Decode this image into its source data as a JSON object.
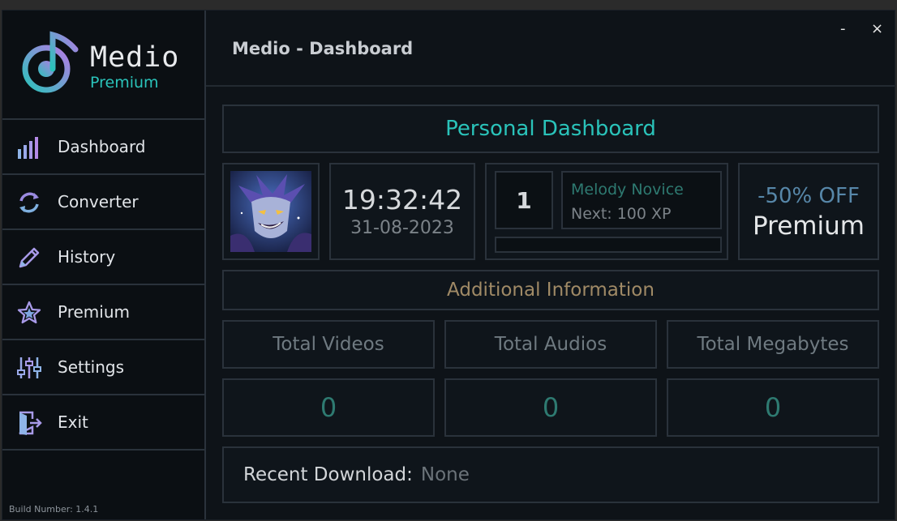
{
  "app": {
    "name": "Medio",
    "tier": "Premium",
    "window_title": "Medio - Dashboard",
    "minimize_glyph": "-",
    "close_glyph": "×",
    "build_number": "Build Number: 1.4.1"
  },
  "sidebar": {
    "items": [
      {
        "label": "Dashboard",
        "icon": "bar-chart-icon"
      },
      {
        "label": "Converter",
        "icon": "refresh-icon"
      },
      {
        "label": "History",
        "icon": "pencil-icon"
      },
      {
        "label": "Premium",
        "icon": "star-icon"
      },
      {
        "label": "Settings",
        "icon": "sliders-icon"
      },
      {
        "label": "Exit",
        "icon": "exit-door-icon"
      }
    ]
  },
  "dashboard": {
    "title": "Personal Dashboard",
    "clock_time": "19:32:42",
    "clock_date": "31-08-2023",
    "level": "1",
    "rank_name": "Melody Novice",
    "next_xp": "Next: 100 XP",
    "xp_progress": 0,
    "promo_discount": "-50% OFF",
    "promo_name": "Premium",
    "info_title": "Additional Information",
    "stats": [
      {
        "label": "Total Videos",
        "value": "0"
      },
      {
        "label": "Total Audios",
        "value": "0"
      },
      {
        "label": "Total Megabytes",
        "value": "0"
      }
    ],
    "recent_label": "Recent Download:",
    "recent_value": "None"
  },
  "colors": {
    "accent": "#2ac3ba",
    "info_title": "#a08a66",
    "stat_value": "#2e7a71",
    "promo": "#5787a9"
  }
}
